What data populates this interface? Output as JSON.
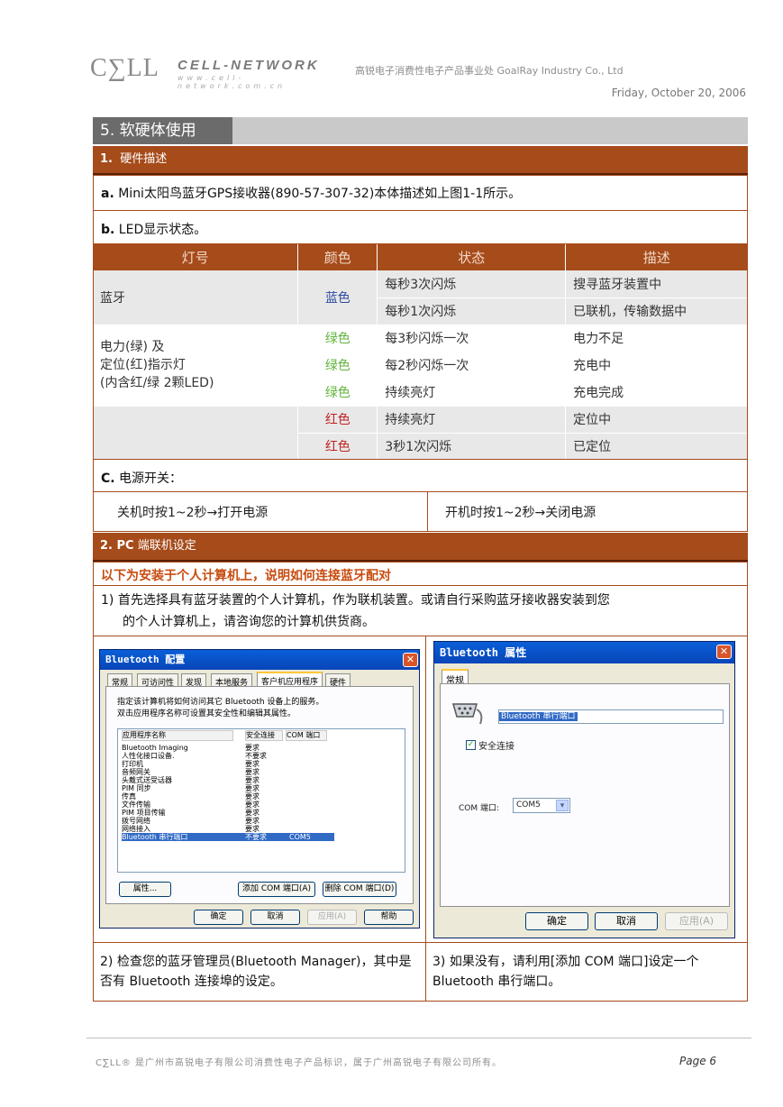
{
  "header": {
    "logo_mark": "C∑LL",
    "logo_name": "CELL-NETWORK",
    "logo_url": "www.cell-network.com.cn",
    "company": "高锐电子消费性电子产品事业处 GoalRay Industry Co., Ltd",
    "date": "Friday, October 20, 2006"
  },
  "section": {
    "title": "5. 软硬体使用"
  },
  "hardware": {
    "heading_num": "1.",
    "heading_text": "硬件描述",
    "a_label": "a.",
    "a_text": "Mini太阳鸟蓝牙GPS接收器(890-57-307-32)本体描述如上图1-1所示。",
    "b_label": "b.",
    "b_text": "LED显示状态。"
  },
  "led_table": {
    "headers": [
      "灯号",
      "颜色",
      "状态",
      "描述"
    ],
    "bluetooth_label": "蓝牙",
    "bluetooth_color": "蓝色",
    "bt_rows": [
      {
        "state": "每秒3次闪烁",
        "desc": "搜寻蓝牙装置中"
      },
      {
        "state": "每秒1次闪烁",
        "desc": "已联机，传输数据中"
      }
    ],
    "power_label_1": "电力(绿) 及",
    "power_label_2": "定位(红)指示灯",
    "power_label_3": "(内含红/绿 2颗LED)",
    "green_rows": [
      {
        "color": "绿色",
        "state": "每3秒闪烁一次",
        "desc": "电力不足"
      },
      {
        "color": "绿色",
        "state": "每2秒闪烁一次",
        "desc": "充电中"
      },
      {
        "color": "绿色",
        "state": "持续亮灯",
        "desc": "充电完成"
      }
    ],
    "red_rows": [
      {
        "color": "红色",
        "state": "持续亮灯",
        "desc": "定位中"
      },
      {
        "color": "红色",
        "state": "3秒1次闪烁",
        "desc": "已定位"
      }
    ]
  },
  "power_switch": {
    "label": "C.",
    "text": "电源开关：",
    "off_to_on": "关机时按1~2秒→打开电源",
    "on_to_off": "开机时按1~2秒→关闭电源"
  },
  "pc": {
    "heading_num": "2. PC",
    "heading_text": "端联机设定",
    "intro": "以下为安装于个人计算机上，说明如何连接蓝牙配对",
    "step1_num": "1)",
    "step1_line1": "首先选择具有蓝牙装置的个人计算机，作为联机装置。或请自行采购蓝牙接收器安装到您",
    "step1_line2": "的个人计算机上，请咨询您的计算机供货商。",
    "step2": "2) 检查您的蓝牙管理员(Bluetooth Manager)，其中是否有 Bluetooth 连接埠的设定。",
    "step3": "3) 如果没有，请利用[添加 COM 端口]设定一个 Bluetooth 串行端口。"
  },
  "win1": {
    "title": "Bluetooth 配置",
    "close": "✕",
    "tabs": [
      "常规",
      "可访问性",
      "发现",
      "本地服务",
      "客户机应用程序",
      "硬件"
    ],
    "desc1": "指定该计算机将如何访问其它 Bluetooth 设备上的服务。",
    "desc2": "双击应用程序名称可设置其安全性和编辑其属性。",
    "col_name": "应用程序名称",
    "col_security": "安全连接",
    "col_com": "COM 端口",
    "apps": [
      {
        "name": "Bluetooth Imaging",
        "security": "要求",
        "com": ""
      },
      {
        "name": "人性化接口设备.",
        "security": "不要求",
        "com": ""
      },
      {
        "name": "打印机",
        "security": "要求",
        "com": ""
      },
      {
        "name": "音频网关",
        "security": "要求",
        "com": ""
      },
      {
        "name": "头戴式送受话器",
        "security": "要求",
        "com": ""
      },
      {
        "name": "PIM 同步",
        "security": "要求",
        "com": ""
      },
      {
        "name": "传真",
        "security": "要求",
        "com": ""
      },
      {
        "name": "文件传输",
        "security": "要求",
        "com": ""
      },
      {
        "name": "PIM 项目传输",
        "security": "要求",
        "com": ""
      },
      {
        "name": "拨号网络",
        "security": "要求",
        "com": ""
      },
      {
        "name": "网络接入",
        "security": "要求",
        "com": ""
      },
      {
        "name": "Bluetooth 串行端口",
        "security": "不要求",
        "com": "COM5"
      }
    ],
    "btn_props": "属性...",
    "btn_add_com": "添加 COM 端口(A)",
    "btn_del_com": "删除 COM 端口(D)",
    "btn_ok": "确定",
    "btn_cancel": "取消",
    "btn_apply": "应用(A)",
    "btn_help": "帮助"
  },
  "win2": {
    "title": "Bluetooth 属性",
    "close": "✕",
    "tab": "常规",
    "name_value": "Bluetooth 串行端口",
    "secure_label": "安全连接",
    "checkbox_mark": "✓",
    "com_label": "COM 端口:",
    "com_value": "COM5",
    "dropdown_arrow": "▾",
    "btn_ok": "确定",
    "btn_cancel": "取消",
    "btn_apply": "应用(A)"
  },
  "footer": {
    "text": "C∑LL® 是广州市高锐电子有限公司消费性电子产品标识，属于广州高锐电子有限公司所有。",
    "page": "Page 6"
  }
}
